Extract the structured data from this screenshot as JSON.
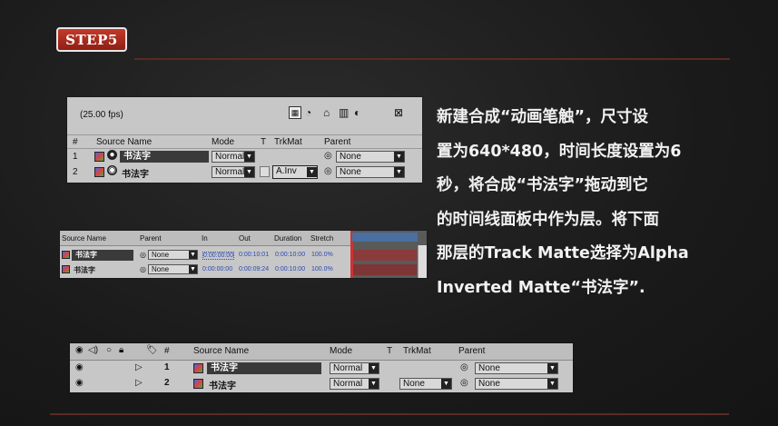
{
  "step": {
    "label": "STEP5"
  },
  "panel1": {
    "fps": "(25.00 fps)",
    "headers": {
      "num": "#",
      "source": "Source Name",
      "mode": "Mode",
      "t": "T",
      "trkmat": "TrkMat",
      "parent": "Parent"
    },
    "rows": [
      {
        "num": "1",
        "name": "书法字",
        "mode": "Normal",
        "trkmat": "",
        "parent": "None"
      },
      {
        "num": "2",
        "name": "书法字",
        "mode": "Normal",
        "trkmat": "A.Inv",
        "parent": "None"
      }
    ]
  },
  "panel2": {
    "headers": {
      "source": "Source Name",
      "parent": "Parent",
      "in": "In",
      "out": "Out",
      "duration": "Duration",
      "stretch": "Stretch"
    },
    "rows": [
      {
        "name": "书法字",
        "parent": "None",
        "in": "0:00:00:00",
        "out": "0:00:10:01",
        "duration": "0:00:10:00",
        "stretch": "100.0%"
      },
      {
        "name": "书法字",
        "parent": "None",
        "in": "0:00:00:00",
        "out": "0:00:09:24",
        "duration": "0:00:10:00",
        "stretch": "100.0%"
      }
    ]
  },
  "panel3": {
    "headers": {
      "num": "#",
      "source": "Source Name",
      "mode": "Mode",
      "t": "T",
      "trkmat": "TrkMat",
      "parent": "Parent"
    },
    "rows": [
      {
        "num": "1",
        "name": "书法字",
        "mode": "Normal",
        "trkmat": "",
        "parent": "None"
      },
      {
        "num": "2",
        "name": "书法字",
        "mode": "Normal",
        "trkmat": "None",
        "parent": "None"
      }
    ]
  },
  "description": {
    "lines": [
      "新建合成“动画笔触”，尺寸设",
      "置为640*480，时间长度设置为6",
      "秒，将合成“书法字”拖动到它",
      "的时间线面板中作为层。将下面",
      "那层的Track Matte选择为Alpha",
      "Inverted Matte“书法字”."
    ]
  },
  "colors": {
    "accent": "#a8291c",
    "background": "#1b1b1b",
    "panel": "#c7c7c7"
  }
}
